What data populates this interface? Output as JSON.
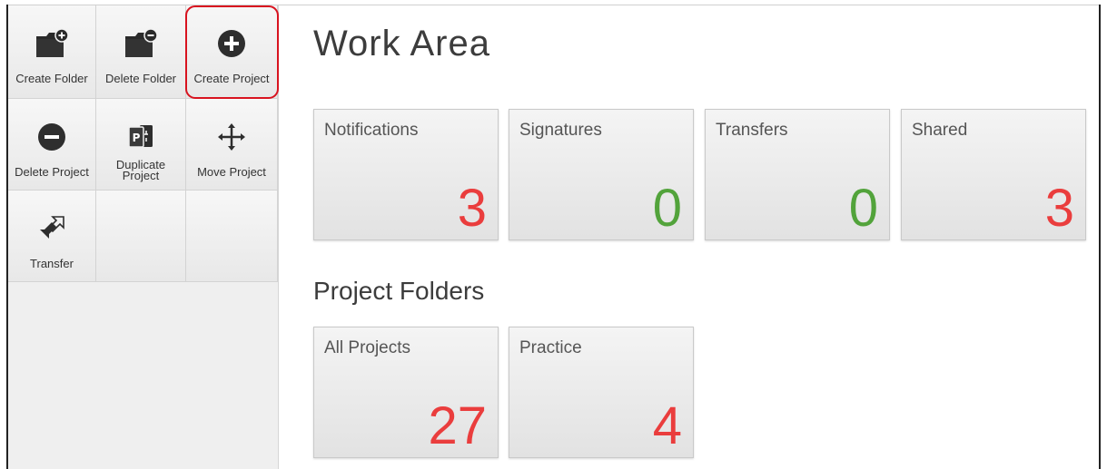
{
  "sidebar": {
    "tools": [
      {
        "label": "Create Folder",
        "icon": "folder-add-icon"
      },
      {
        "label": "Delete Folder",
        "icon": "folder-remove-icon"
      },
      {
        "label": "Create Project",
        "icon": "plus-circle-icon"
      },
      {
        "label": "Delete Project",
        "icon": "minus-circle-icon"
      },
      {
        "label": "Duplicate Project",
        "icon": "duplicate-project-icon"
      },
      {
        "label": "Move Project",
        "icon": "move-arrows-icon"
      },
      {
        "label": "Transfer",
        "icon": "transfer-arrows-icon"
      }
    ]
  },
  "main": {
    "title": "Work Area",
    "status_tiles": [
      {
        "label": "Notifications",
        "count": "3",
        "color": "#ea3d3d"
      },
      {
        "label": "Signatures",
        "count": "0",
        "color": "#52a33b"
      },
      {
        "label": "Transfers",
        "count": "0",
        "color": "#52a33b"
      },
      {
        "label": "Shared",
        "count": "3",
        "color": "#ea3d3d"
      }
    ],
    "folders_title": "Project Folders",
    "folder_tiles": [
      {
        "label": "All Projects",
        "count": "27",
        "color": "#ea3d3d"
      },
      {
        "label": "Practice",
        "count": "4",
        "color": "#ea3d3d"
      }
    ]
  },
  "highlight_color": "#d8131f"
}
